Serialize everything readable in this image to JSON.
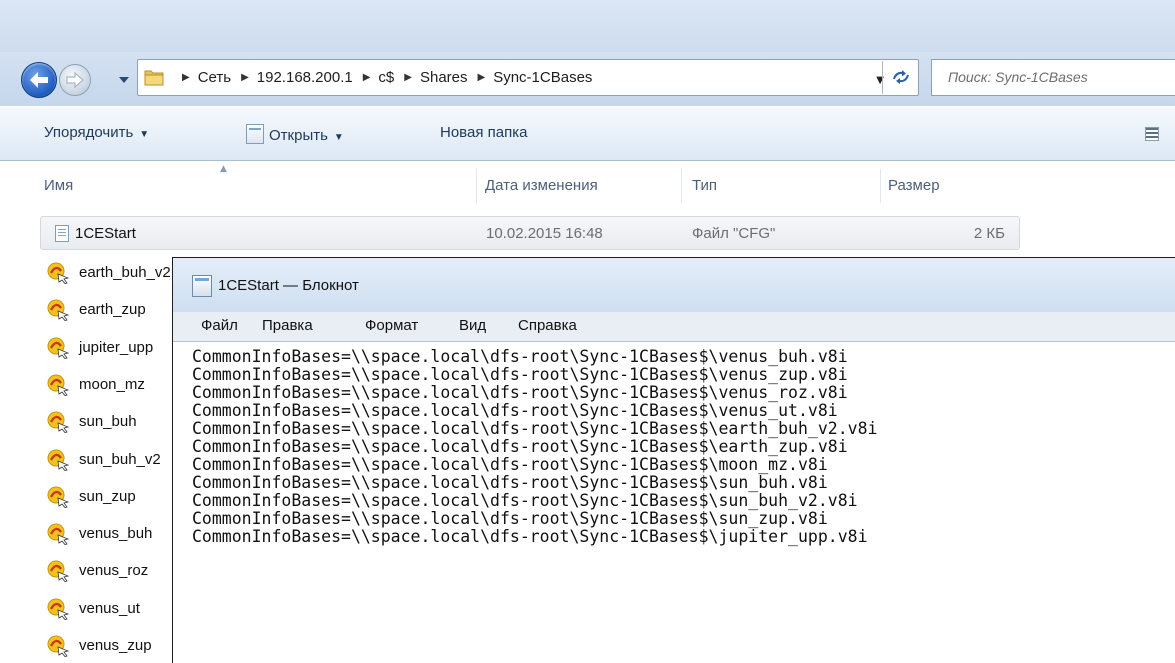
{
  "explorer": {
    "breadcrumb": [
      "Сеть",
      "192.168.200.1",
      "c$",
      "Shares",
      "Sync-1CBases"
    ],
    "search_placeholder": "Поиск: Sync-1CBases",
    "toolbar": {
      "organize": "Упорядочить",
      "open": "Открыть",
      "new_folder": "Новая папка"
    },
    "columns": {
      "name": "Имя",
      "date": "Дата изменения",
      "type": "Тип",
      "size": "Размер"
    },
    "selected_file": {
      "name": "1CEStart",
      "date": "10.02.2015 16:48",
      "type": "Файл \"CFG\"",
      "size": "2 КБ"
    },
    "files": [
      "earth_buh_v2",
      "earth_zup",
      "jupiter_upp",
      "moon_mz",
      "sun_buh",
      "sun_buh_v2",
      "sun_zup",
      "venus_buh",
      "venus_roz",
      "venus_ut",
      "venus_zup"
    ]
  },
  "notepad": {
    "title": "1CEStart — Блокнот",
    "menu": [
      "Файл",
      "Правка",
      "Формат",
      "Вид",
      "Справка"
    ],
    "lines": [
      "CommonInfoBases=\\\\space.local\\dfs-root\\Sync-1CBases$\\venus_buh.v8i",
      "CommonInfoBases=\\\\space.local\\dfs-root\\Sync-1CBases$\\venus_zup.v8i",
      "CommonInfoBases=\\\\space.local\\dfs-root\\Sync-1CBases$\\venus_roz.v8i",
      "CommonInfoBases=\\\\space.local\\dfs-root\\Sync-1CBases$\\venus_ut.v8i",
      "CommonInfoBases=\\\\space.local\\dfs-root\\Sync-1CBases$\\earth_buh_v2.v8i",
      "CommonInfoBases=\\\\space.local\\dfs-root\\Sync-1CBases$\\earth_zup.v8i",
      "CommonInfoBases=\\\\space.local\\dfs-root\\Sync-1CBases$\\moon_mz.v8i",
      "CommonInfoBases=\\\\space.local\\dfs-root\\Sync-1CBases$\\sun_buh.v8i",
      "CommonInfoBases=\\\\space.local\\dfs-root\\Sync-1CBases$\\sun_buh_v2.v8i",
      "CommonInfoBases=\\\\space.local\\dfs-root\\Sync-1CBases$\\sun_zup.v8i",
      "CommonInfoBases=\\\\space.local\\dfs-root\\Sync-1CBases$\\jupiter_upp.v8i"
    ]
  },
  "icons": {
    "back": "arrow-left-icon",
    "forward": "arrow-right-icon",
    "folder": "folder-icon",
    "refresh": "refresh-icon",
    "cfg_file": "text-file-icon",
    "v8i_file": "1c-base-icon",
    "notepad": "notepad-icon"
  },
  "colors": {
    "accent": "#1d5bbf",
    "text": "#1e395b",
    "muted": "#6d6d6d",
    "selection": "#e9ecef"
  }
}
